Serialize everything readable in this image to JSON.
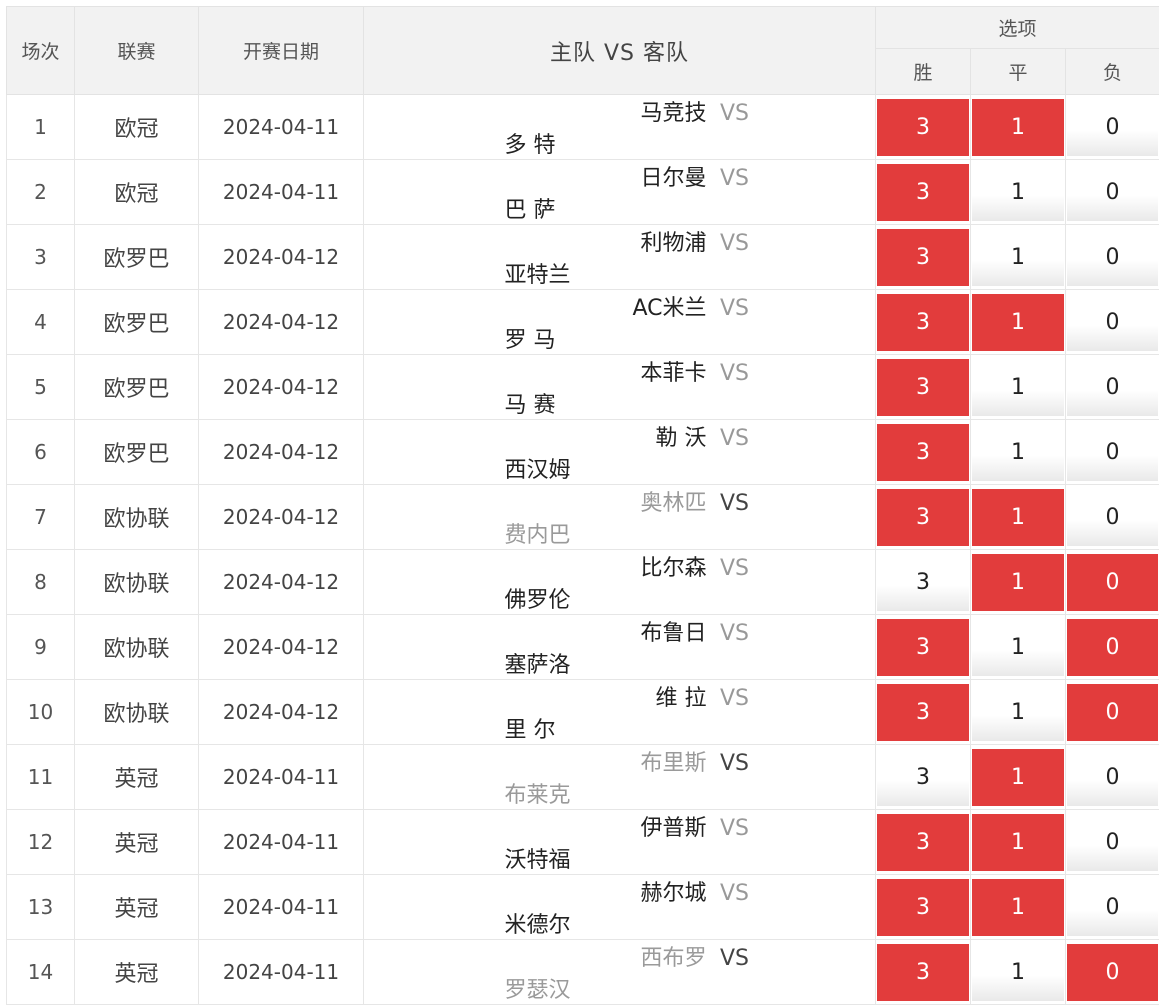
{
  "header": {
    "col_round": "场次",
    "col_league": "联赛",
    "col_date": "开赛日期",
    "col_teams": "主队 VS 客队",
    "col_options": "选项",
    "opt_win": "胜",
    "opt_draw": "平",
    "opt_loss": "负"
  },
  "colors": {
    "selected": "#e23c3c",
    "vs_text": "#999999",
    "muted_team": "#9a9a9a"
  },
  "rows": [
    {
      "no": "1",
      "league": "欧冠",
      "date": "2024-04-11",
      "home": "马竞技",
      "vs": "VS",
      "away": "多 特",
      "win": "3",
      "draw": "1",
      "loss": "0",
      "sel": [
        true,
        true,
        false
      ],
      "muted": false
    },
    {
      "no": "2",
      "league": "欧冠",
      "date": "2024-04-11",
      "home": "日尔曼",
      "vs": "VS",
      "away": "巴 萨",
      "win": "3",
      "draw": "1",
      "loss": "0",
      "sel": [
        true,
        false,
        false
      ],
      "muted": false
    },
    {
      "no": "3",
      "league": "欧罗巴",
      "date": "2024-04-12",
      "home": "利物浦",
      "vs": "VS",
      "away": "亚特兰",
      "win": "3",
      "draw": "1",
      "loss": "0",
      "sel": [
        true,
        false,
        false
      ],
      "muted": false
    },
    {
      "no": "4",
      "league": "欧罗巴",
      "date": "2024-04-12",
      "home": "AC米兰",
      "vs": "VS",
      "away": "罗 马",
      "win": "3",
      "draw": "1",
      "loss": "0",
      "sel": [
        true,
        true,
        false
      ],
      "muted": false
    },
    {
      "no": "5",
      "league": "欧罗巴",
      "date": "2024-04-12",
      "home": "本菲卡",
      "vs": "VS",
      "away": "马 赛",
      "win": "3",
      "draw": "1",
      "loss": "0",
      "sel": [
        true,
        false,
        false
      ],
      "muted": false
    },
    {
      "no": "6",
      "league": "欧罗巴",
      "date": "2024-04-12",
      "home": "勒 沃",
      "vs": "VS",
      "away": "西汉姆",
      "win": "3",
      "draw": "1",
      "loss": "0",
      "sel": [
        true,
        false,
        false
      ],
      "muted": false
    },
    {
      "no": "7",
      "league": "欧协联",
      "date": "2024-04-12",
      "home": "奥林匹",
      "vs": "VS",
      "away": "费内巴",
      "win": "3",
      "draw": "1",
      "loss": "0",
      "sel": [
        true,
        true,
        false
      ],
      "muted": true
    },
    {
      "no": "8",
      "league": "欧协联",
      "date": "2024-04-12",
      "home": "比尔森",
      "vs": "VS",
      "away": "佛罗伦",
      "win": "3",
      "draw": "1",
      "loss": "0",
      "sel": [
        false,
        true,
        true
      ],
      "muted": false
    },
    {
      "no": "9",
      "league": "欧协联",
      "date": "2024-04-12",
      "home": "布鲁日",
      "vs": "VS",
      "away": "塞萨洛",
      "win": "3",
      "draw": "1",
      "loss": "0",
      "sel": [
        true,
        false,
        true
      ],
      "muted": false
    },
    {
      "no": "10",
      "league": "欧协联",
      "date": "2024-04-12",
      "home": "维 拉",
      "vs": "VS",
      "away": "里 尔",
      "win": "3",
      "draw": "1",
      "loss": "0",
      "sel": [
        true,
        false,
        true
      ],
      "muted": false
    },
    {
      "no": "11",
      "league": "英冠",
      "date": "2024-04-11",
      "home": "布里斯",
      "vs": "VS",
      "away": "布莱克",
      "win": "3",
      "draw": "1",
      "loss": "0",
      "sel": [
        false,
        true,
        false
      ],
      "muted": true
    },
    {
      "no": "12",
      "league": "英冠",
      "date": "2024-04-11",
      "home": "伊普斯",
      "vs": "VS",
      "away": "沃特福",
      "win": "3",
      "draw": "1",
      "loss": "0",
      "sel": [
        true,
        true,
        false
      ],
      "muted": false
    },
    {
      "no": "13",
      "league": "英冠",
      "date": "2024-04-11",
      "home": "赫尔城",
      "vs": "VS",
      "away": "米德尔",
      "win": "3",
      "draw": "1",
      "loss": "0",
      "sel": [
        true,
        true,
        false
      ],
      "muted": false
    },
    {
      "no": "14",
      "league": "英冠",
      "date": "2024-04-11",
      "home": "西布罗",
      "vs": "VS",
      "away": "罗瑟汉",
      "win": "3",
      "draw": "1",
      "loss": "0",
      "sel": [
        true,
        false,
        true
      ],
      "muted": true
    }
  ]
}
